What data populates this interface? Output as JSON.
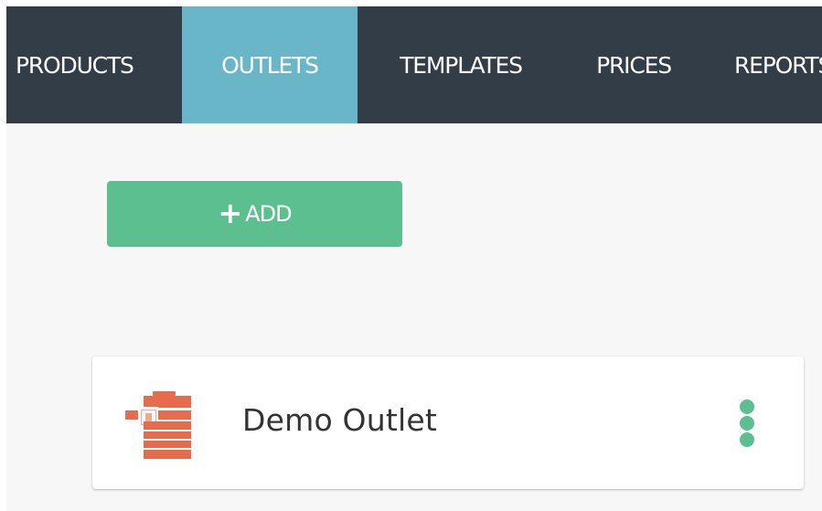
{
  "nav": {
    "tabs": [
      {
        "label": "PRODUCTS",
        "active": false
      },
      {
        "label": "OUTLETS",
        "active": true
      },
      {
        "label": "TEMPLATES",
        "active": false
      },
      {
        "label": "PRICES",
        "active": false
      },
      {
        "label": "REPORTS",
        "active": false
      }
    ]
  },
  "toolbar": {
    "add_icon": "+",
    "add_label": "ADD"
  },
  "outlets": [
    {
      "name": "Demo Outlet",
      "icon": "printer-icon",
      "menu_icon": "more-vertical-icon"
    }
  ],
  "colors": {
    "navbar": "#333d48",
    "active_tab": "#6ab6c9",
    "add_button": "#5bbf8f",
    "printer_icon": "#e76c4d",
    "more_menu_icon": "#5bbf8f"
  }
}
